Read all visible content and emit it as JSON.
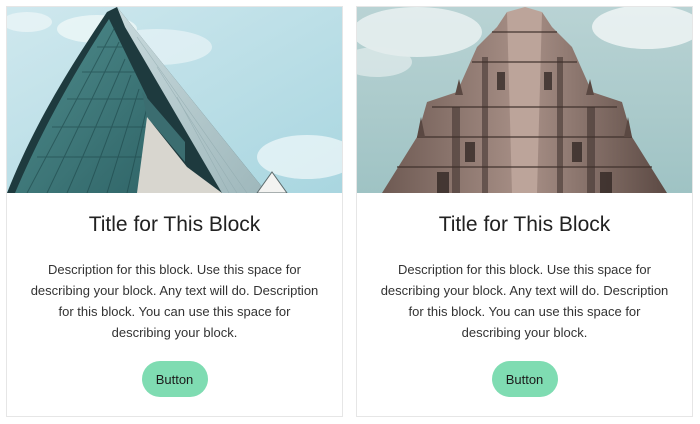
{
  "cards": [
    {
      "image": "modern-glass-building-photo",
      "title": "Title for This Block",
      "description": "Description for this block. Use this space for describing your block. Any text will do. Description for this block. You can use this space for describing your block.",
      "button_label": "Button"
    },
    {
      "image": "ornate-stone-tower-photo",
      "title": "Title for This Block",
      "description": "Description for this block. Use this space for describing your block. Any text will do. Description for this block. You can use this space for describing your block.",
      "button_label": "Button"
    }
  ],
  "colors": {
    "button_bg": "#7fdcb2",
    "card_border": "#e6e6e6",
    "title_text": "#222222",
    "body_text": "#333333"
  }
}
